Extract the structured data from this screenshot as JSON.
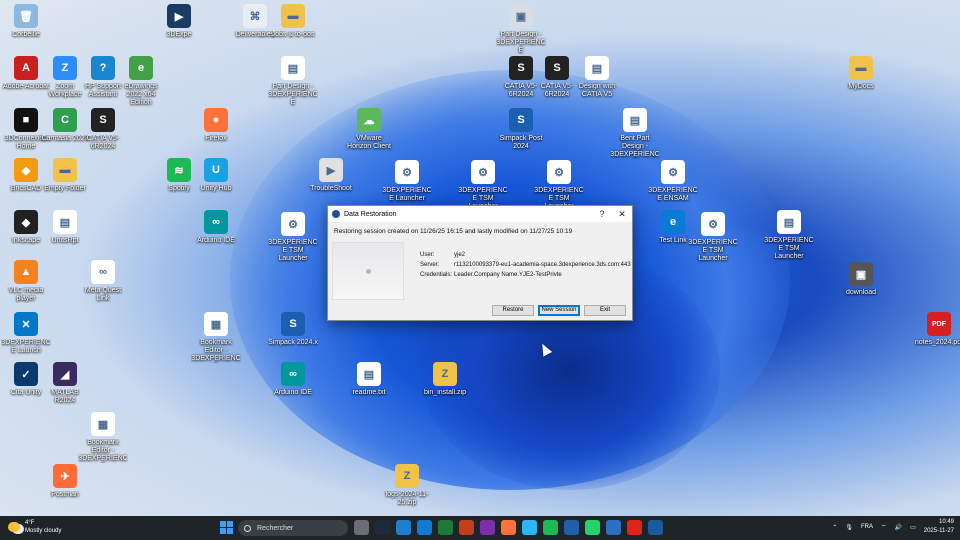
{
  "desktop": {
    "icons": [
      {
        "label": "Corbeille",
        "color": "#8fb8e0",
        "glyph": "🗑"
      },
      {
        "label": "3DExpe",
        "color": "#1a3b63",
        "glyph": "▶"
      },
      {
        "label": "Deliverables",
        "color": "#e8eef6",
        "glyph": "⌘"
      },
      {
        "label": "Jobs & to-dos",
        "color": "#f0c24a",
        "glyph": "▬"
      },
      {
        "label": "Part Design - 3DEXPERIENCE",
        "color": "#d8dde3",
        "glyph": "▣"
      },
      {
        "label": "Adobe Acrobat",
        "color": "#c8201f",
        "glyph": "A"
      },
      {
        "label": "Zoom Workplace",
        "color": "#2d8cff",
        "glyph": "Z"
      },
      {
        "label": "HP Support Assistant",
        "color": "#1a86d0",
        "glyph": "?"
      },
      {
        "label": "eDrawings 2022 x64 Edition",
        "color": "#43a047",
        "glyph": "e"
      },
      {
        "label": "Part Design - 3DEXPERIENCE",
        "color": "#ffffff",
        "glyph": "▤"
      },
      {
        "label": "CATIA V5-6R2024",
        "color": "#222222",
        "glyph": "S"
      },
      {
        "label": "CATIA V5-6R2024",
        "color": "#222222",
        "glyph": "S"
      },
      {
        "label": "Design with CATIA V5",
        "color": "#ffffff",
        "glyph": "▤"
      },
      {
        "label": "MyDocs",
        "color": "#f0c24a",
        "glyph": "▬"
      },
      {
        "label": "3DConnexion Home",
        "color": "#111111",
        "glyph": "■"
      },
      {
        "label": "Camtasia 2023",
        "color": "#2e9e4f",
        "glyph": "C"
      },
      {
        "label": "CATIA V5-6R2024",
        "color": "#222222",
        "glyph": "S"
      },
      {
        "label": "Firefox",
        "color": "#ff7139",
        "glyph": "●"
      },
      {
        "label": "VMware Horizon Client",
        "color": "#5cb85c",
        "glyph": "☁"
      },
      {
        "label": "Simpack Post 2024",
        "color": "#1b5fb0",
        "glyph": "S"
      },
      {
        "label": "Bent Part Design - 3DEXPERIENCE",
        "color": "#ffffff",
        "glyph": "▤"
      },
      {
        "label": "BricsCAD",
        "color": "#f39c12",
        "glyph": "◆"
      },
      {
        "label": "Empty Folder",
        "color": "#f0c24a",
        "glyph": "▬"
      },
      {
        "label": "Spotify",
        "color": "#1db954",
        "glyph": "≋"
      },
      {
        "label": "Unity Hub",
        "color": "#1ba1e2",
        "glyph": "U"
      },
      {
        "label": "TroubleShoot",
        "color": "#e0e0e0",
        "glyph": "▶"
      },
      {
        "label": "3DEXPERIENCE Launcher",
        "color": "#ffffff",
        "glyph": "⚙"
      },
      {
        "label": "3DEXPERIENCE TSM Launcher",
        "color": "#ffffff",
        "glyph": "⚙"
      },
      {
        "label": "3DEXPERIENCE TSM Launcher",
        "color": "#ffffff",
        "glyph": "⚙"
      },
      {
        "label": "3DEXPERIENCE ENSAM",
        "color": "#ffffff",
        "glyph": "⚙"
      },
      {
        "label": "Inkscape",
        "color": "#222222",
        "glyph": "◆"
      },
      {
        "label": "UnitsRpt",
        "color": "#ffffff",
        "glyph": "▤"
      },
      {
        "label": "Arduino IDE",
        "color": "#00979d",
        "glyph": "∞"
      },
      {
        "label": "3DEXPERIENCE TSM Launcher",
        "color": "#ffffff",
        "glyph": "⚙"
      },
      {
        "label": "Test Link",
        "color": "#0a7bd4",
        "glyph": "e"
      },
      {
        "label": "3DEXPERIENCE TSM Launcher",
        "color": "#ffffff",
        "glyph": "⚙"
      },
      {
        "label": "3DEXPERIENCE TSM Launcher",
        "color": "#ffffff",
        "glyph": "▤"
      },
      {
        "label": "VLC media player",
        "color": "#f58220",
        "glyph": "▲"
      },
      {
        "label": "Meta Quest Link",
        "color": "#ffffff",
        "glyph": "∞"
      },
      {
        "label": "3DEXPERIENCE Launch",
        "color": "#0077c8",
        "glyph": "✕"
      },
      {
        "label": "Bookmark Editor - 3DEXPERIENCE",
        "color": "#ffffff",
        "glyph": "▦"
      },
      {
        "label": "Simpack 2024.x",
        "color": "#1b5fb0",
        "glyph": "S"
      },
      {
        "label": "download",
        "color": "#555555",
        "glyph": "▣"
      },
      {
        "label": "notes_2024.pdf",
        "color": "#d42020",
        "glyph": "PDF"
      },
      {
        "label": "Cita Unity",
        "color": "#0b3b6e",
        "glyph": "✓"
      },
      {
        "label": "MATLAB R2024",
        "color": "#3a2b5f",
        "glyph": "◢"
      },
      {
        "label": "Arduino IDE",
        "color": "#00979d",
        "glyph": "∞"
      },
      {
        "label": "readme.txt",
        "color": "#ffffff",
        "glyph": "▤"
      },
      {
        "label": "bin_install.zip",
        "color": "#f0c24a",
        "glyph": "Z"
      },
      {
        "label": "Bookmark Editor - 3DEXPERIENCE",
        "color": "#ffffff",
        "glyph": "▦"
      },
      {
        "label": "Postman",
        "color": "#ff6c37",
        "glyph": "✈"
      },
      {
        "label": "logs-2024-11-25.zip",
        "color": "#f0c24a",
        "glyph": "Z"
      }
    ]
  },
  "dialog": {
    "title": "Data Restoration",
    "help": "?",
    "close": "✕",
    "message": "Restoring session created on 11/26/25 16:15 and lastly modified on 11/27/25 10:19",
    "user_label": "User:",
    "user_value": "yje2",
    "server_label": "Server:",
    "server_value": "r1132100093379-eu1-academia-space.3dexperience.3ds.com:443",
    "credentials_label": "Credentials:",
    "credentials_value": "Leader.Company Name.YJE2-TestPrivte",
    "restore_label": "Restore",
    "new_session_label": "New Session",
    "exit_label": "Exit"
  },
  "taskbar": {
    "weather_temp": "4°F",
    "weather_desc": "Mostly cloudy",
    "search_placeholder": "Rechercher",
    "apps": [
      "#6b6f75",
      "#1c2a3a",
      "#1e7fd0",
      "#0f7bd4",
      "#1f7a3a",
      "#c43e1c",
      "#7b2fa8",
      "#ff7139",
      "#2db6f5",
      "#1db954",
      "#1e5fa8",
      "#25d366",
      "#2d6fc4",
      "#e2231a",
      "#1c5a9e"
    ],
    "lang": "FRA",
    "time": "10:49",
    "date": "2025-11-27"
  }
}
